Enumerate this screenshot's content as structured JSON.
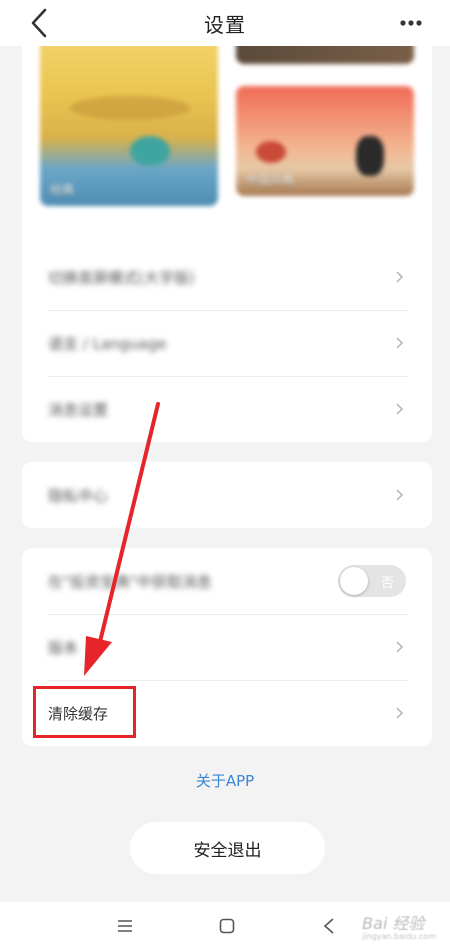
{
  "header": {
    "title": "设置"
  },
  "themes": {
    "left_label": "经典",
    "right_label": "中国风格"
  },
  "card1": {
    "items": [
      {
        "label": "切换首屏模式(大字版)"
      },
      {
        "label": "语言 / Language"
      },
      {
        "label": "消息设置"
      }
    ]
  },
  "card2": {
    "items": [
      {
        "label": "隐私中心"
      }
    ]
  },
  "card3": {
    "items": [
      {
        "label": "在\"投资宝典\"中获取消息"
      },
      {
        "label": "版本"
      },
      {
        "label": "清除缓存"
      }
    ],
    "toggle_text": "否",
    "toggle_on": false
  },
  "about_label": "关于APP",
  "logout_label": "安全退出",
  "watermark": {
    "text": "Bai 经验",
    "sub": "jingyan.baidu.com"
  },
  "colors": {
    "accent_link": "#3a86d6",
    "highlight": "#e8242b"
  },
  "icons": {
    "back": "chevron-left-icon",
    "more": "more-dots-icon",
    "row": "chevron-right-icon"
  }
}
